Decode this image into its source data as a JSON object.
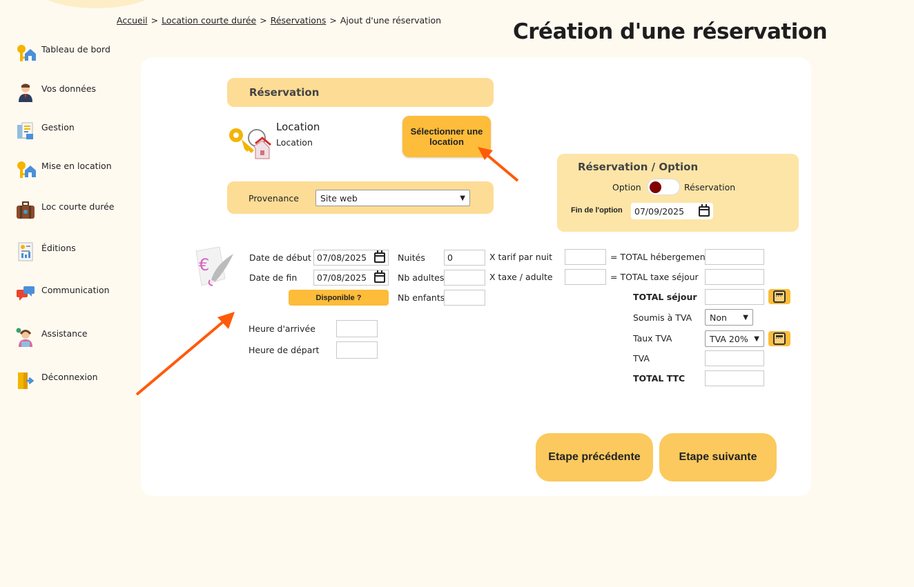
{
  "breadcrumb": {
    "items": [
      "Accueil",
      "Location courte durée",
      "Réservations"
    ],
    "current": "Ajout d'une réservation",
    "separator": ">"
  },
  "page_title": "Création d'une réservation",
  "sidebar": {
    "items": [
      {
        "label": "Tableau de bord",
        "icon": "keys-house-icon"
      },
      {
        "label": "Vos données",
        "icon": "user-icon"
      },
      {
        "label": "Gestion",
        "icon": "documents-icon"
      },
      {
        "label": "Mise en location",
        "icon": "keys-house-icon"
      },
      {
        "label": "Loc courte durée",
        "icon": "suitcase-icon"
      },
      {
        "label": "Éditions",
        "icon": "report-icon"
      },
      {
        "label": "Communication",
        "icon": "chat-bubbles-icon"
      },
      {
        "label": "Assistance",
        "icon": "support-agent-icon"
      },
      {
        "label": "Déconnexion",
        "icon": "logout-icon"
      }
    ]
  },
  "reservation": {
    "section_title": "Réservation",
    "location_title": "Location",
    "location_subtitle": "Location",
    "select_location_label": "Sélectionner une location",
    "provenance_label": "Provenance",
    "provenance_value": "Site web"
  },
  "option_panel": {
    "title": "Réservation / Option",
    "toggle_left": "Option",
    "toggle_right": "Réservation",
    "end_option_label": "Fin de l'option",
    "end_option_value": "07/09/2025"
  },
  "dates": {
    "start_label": "Date de début",
    "start_value": "07/08/2025",
    "end_label": "Date de fin",
    "end_value": "07/08/2025",
    "available_label": "Disponible ?",
    "arrival_label": "Heure d'arrivée",
    "arrival_value": "",
    "departure_label": "Heure de départ",
    "departure_value": ""
  },
  "counts": {
    "nights_label": "Nuités",
    "nights_value": "0",
    "adults_label": "Nb adultes",
    "adults_value": "",
    "children_label": "Nb enfants",
    "children_value": ""
  },
  "pricing": {
    "rate_label": "X tarif par nuit",
    "rate_value": "",
    "tax_label": "X taxe / adulte",
    "tax_value": "",
    "total_lodging_label": "= TOTAL hébergement",
    "total_lodging_value": "",
    "total_tax_label": "= TOTAL taxe séjour",
    "total_tax_value": "",
    "total_stay_label": "TOTAL séjour",
    "total_stay_value": "",
    "vat_subject_label": "Soumis à TVA",
    "vat_subject_value": "Non",
    "vat_rate_label": "Taux TVA",
    "vat_rate_value": "TVA 20%",
    "vat_label": "TVA",
    "vat_value": "",
    "total_ttc_label": "TOTAL TTC",
    "total_ttc_value": ""
  },
  "steps": {
    "prev_label": "Etape précédente",
    "next_label": "Etape suivante"
  },
  "colors": {
    "background": "#fffaf0",
    "section": "#fddc95",
    "accent": "#fdbc3a",
    "arrow": "#ff5a0a",
    "toggle_knob": "#800000"
  }
}
